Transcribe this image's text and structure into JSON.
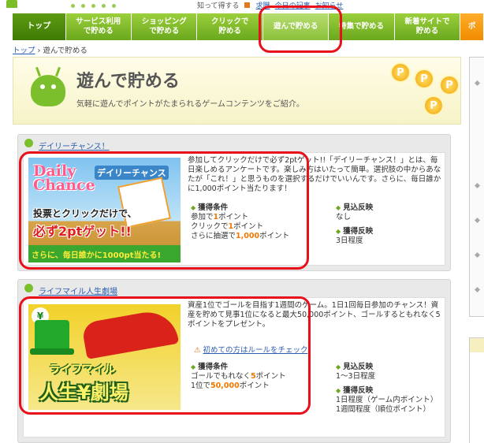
{
  "top_links": {
    "prefix": "知って得する",
    "link1": "求職",
    "link2": "今日の記事",
    "link3": "お知らせ"
  },
  "nav": {
    "tabs": [
      {
        "label": "トップ"
      },
      {
        "label": "サービス利用\nで貯める"
      },
      {
        "label": "ショッピング\nで貯める"
      },
      {
        "label": "クリックで\n貯める"
      },
      {
        "label": "遊んで貯める"
      },
      {
        "label": "特集で貯める"
      },
      {
        "label": "新着サイトで\n貯める"
      },
      {
        "label": "ポ"
      }
    ]
  },
  "breadcrumb": {
    "home": "トップ",
    "sep": "›",
    "current": "遊んで貯める"
  },
  "banner": {
    "title": "遊んで貯める",
    "subtitle": "気軽に遊んでポイントがたまられるゲームコンテンツをご紹介。",
    "coin_label": "P"
  },
  "sections": [
    {
      "title": "デイリーチャンス！",
      "description": "参加してクリックだけで必ず2ptゲット!!「デイリーチャンス！」とは、毎日楽しめるアンケートです。楽しみ方はいたって簡単。選択肢の中からあなたが「これ！」と思うものを選択するだけでいいんです。さらに、毎日誰かに1,000ポイント当たります！",
      "thumb": {
        "logo_line1": "Daily",
        "logo_line2": "Chance",
        "jp_title": "デイリーチャンス",
        "line1": "投票とクリックだけで、",
        "line2": "必ず2ptゲット!!",
        "line3": "さらに、毎日誰かに1000pt当たる!"
      },
      "conditions": {
        "label": "獲得条件",
        "row1_pre": "参加で",
        "row1_hl": "1",
        "row1_post": "ポイント",
        "row2_pre": "クリックで",
        "row2_hl": "1",
        "row2_post": "ポイント",
        "row3_pre": "さらに抽選で",
        "row3_hl": "1,000",
        "row3_post": "ポイント"
      },
      "expect": {
        "label": "見込反映",
        "value": "なし"
      },
      "reflect": {
        "label": "獲得反映",
        "value": "3日程度"
      }
    },
    {
      "title": "ライフマイル人生劇場",
      "description": "資産1位でゴールを目指す1週間のゲーム。1日1回毎日参加のチャンス！資産を貯めて見事1位になると最大50,000ポイント、ゴールするともれなく5ポイントをプレゼント。",
      "rule_link": "初めての方はルールをチェック",
      "thumb": {
        "tag": "¥",
        "line1": "ライフマイル",
        "line2": "人生¥劇場"
      },
      "conditions": {
        "label": "獲得条件",
        "row1_pre": "ゴールでもれなく",
        "row1_hl": "5",
        "row1_post": "ポイント",
        "row2_pre": "1位で",
        "row2_hl": "50,000",
        "row2_post": "ポイント"
      },
      "expect": {
        "label": "見込反映",
        "value": "1〜3日程度"
      },
      "reflect": {
        "label": "獲得反映",
        "value1": "1日程度（ゲーム内ポイント）",
        "value2": "1週間程度（順位ポイント）"
      }
    }
  ],
  "colors": {
    "nav_green": "#7cbd2a",
    "annotation_red": "#e8101a",
    "link_blue": "#2a5db0",
    "highlight_orange": "#f07800"
  }
}
